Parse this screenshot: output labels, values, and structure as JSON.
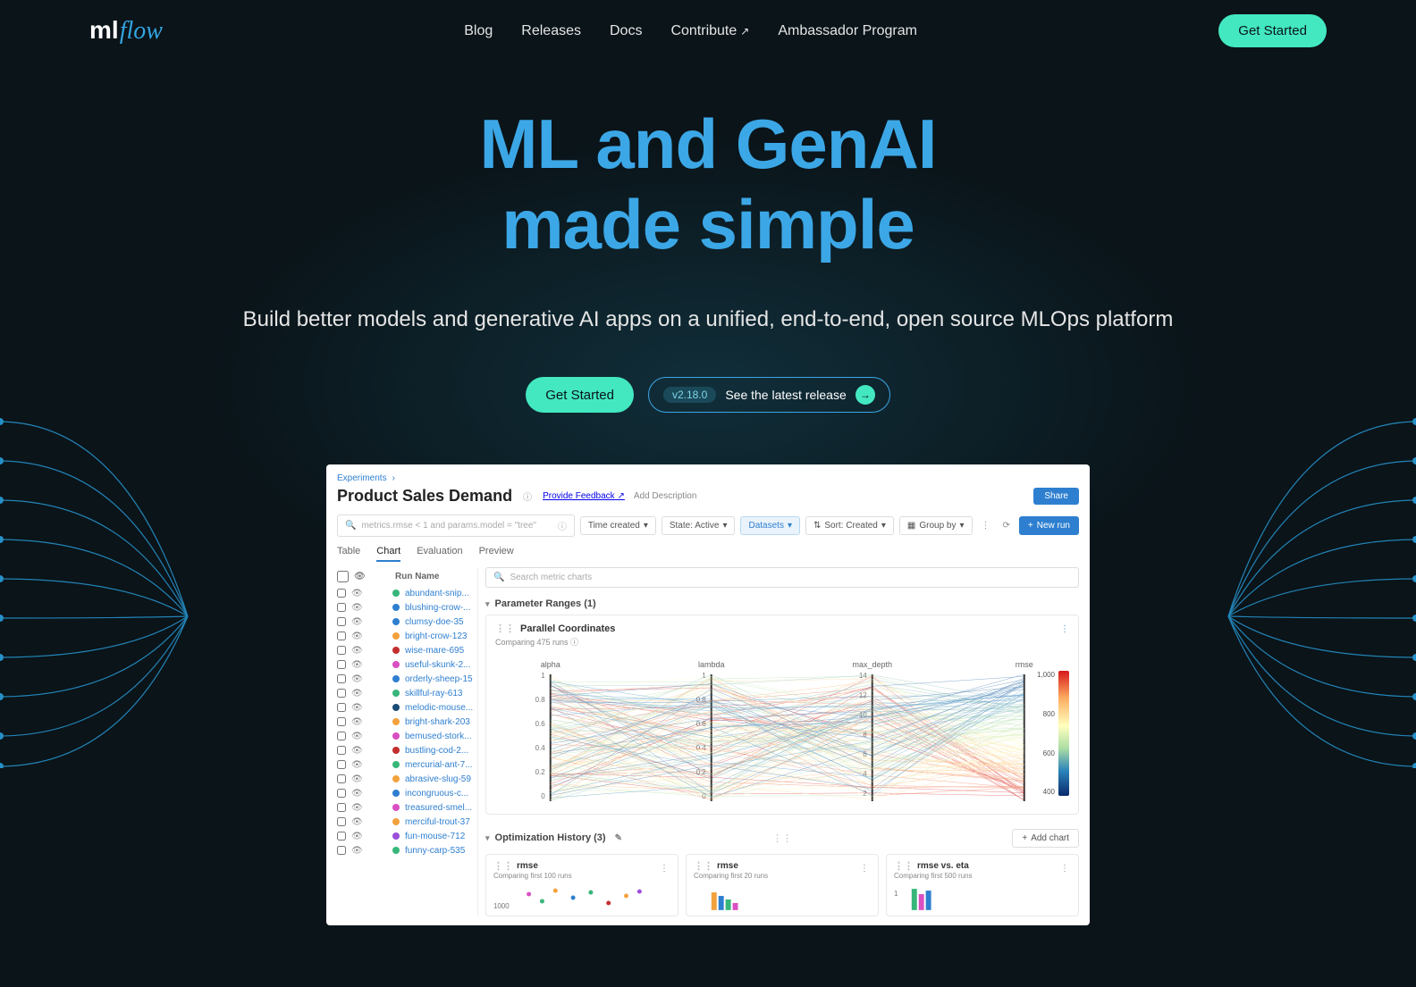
{
  "nav": {
    "logo_ml": "ml",
    "logo_flow": "flow",
    "links": [
      "Blog",
      "Releases",
      "Docs",
      "Contribute",
      "Ambassador Program"
    ],
    "cta": "Get Started"
  },
  "hero": {
    "title_line1": "ML and GenAI",
    "title_line2": "made simple",
    "subtitle": "Build better models and generative AI apps on a unified, end-to-end, open source MLOps platform",
    "cta_primary": "Get Started",
    "release_version": "v2.18.0",
    "release_label": "See the latest release"
  },
  "screenshot": {
    "breadcrumb": "Experiments",
    "title": "Product Sales Demand",
    "feedback": "Provide Feedback",
    "add_desc": "Add Description",
    "share": "Share",
    "search_value": "metrics.rmse < 1 and params.model = \"tree\"",
    "filters": {
      "time": "Time created",
      "state": "State: Active",
      "datasets": "Datasets",
      "sort": "Sort: Created",
      "group": "Group by"
    },
    "newrun": "New run",
    "tabs": [
      "Table",
      "Chart",
      "Evaluation",
      "Preview"
    ],
    "active_tab": "Chart",
    "run_header": "Run Name",
    "runs": [
      {
        "color": "#37b679",
        "name": "abundant-snip..."
      },
      {
        "color": "#2e7fd0",
        "name": "blushing-crow-..."
      },
      {
        "color": "#2e7fd0",
        "name": "clumsy-doe-35"
      },
      {
        "color": "#f2a23d",
        "name": "bright-crow-123"
      },
      {
        "color": "#c32f2f",
        "name": "wise-mare-695"
      },
      {
        "color": "#d94fc2",
        "name": "useful-skunk-2..."
      },
      {
        "color": "#2e7fd0",
        "name": "orderly-sheep-15"
      },
      {
        "color": "#37b679",
        "name": "skillful-ray-613"
      },
      {
        "color": "#1b4c78",
        "name": "melodic-mouse..."
      },
      {
        "color": "#f2a23d",
        "name": "bright-shark-203"
      },
      {
        "color": "#d94fc2",
        "name": "bemused-stork..."
      },
      {
        "color": "#c32f2f",
        "name": "bustling-cod-2..."
      },
      {
        "color": "#37b679",
        "name": "mercurial-ant-7..."
      },
      {
        "color": "#f2a23d",
        "name": "abrasive-slug-59"
      },
      {
        "color": "#2e7fd0",
        "name": "incongruous-c..."
      },
      {
        "color": "#d94fc2",
        "name": "treasured-smel..."
      },
      {
        "color": "#f2a23d",
        "name": "merciful-trout-37"
      },
      {
        "color": "#9c4fd9",
        "name": "fun-mouse-712"
      },
      {
        "color": "#37b679",
        "name": "funny-carp-535"
      }
    ],
    "chart_search_placeholder": "Search metric charts",
    "param_ranges": "Parameter Ranges (1)",
    "parallel": {
      "title": "Parallel Coordinates",
      "sub": "Comparing 475 runs",
      "axes": [
        "alpha",
        "lambda",
        "max_depth",
        "rmse"
      ],
      "ticks_01": [
        "1",
        "0.8",
        "0.6",
        "0.4",
        "0.2",
        "0"
      ],
      "depth_ticks": [
        "14",
        "12",
        "10",
        "8",
        "6",
        "4",
        "2"
      ],
      "cb_labels": [
        "1,000",
        "800",
        "600",
        "400"
      ]
    },
    "opt_history": "Optimization History (3)",
    "add_chart": "Add chart",
    "panels": [
      {
        "title": "rmse",
        "sub": "Comparing first 100 runs"
      },
      {
        "title": "rmse",
        "sub": "Comparing first 20 runs"
      },
      {
        "title": "rmse vs. eta",
        "sub": "Comparing first 500 runs"
      }
    ],
    "ytick": "1000"
  }
}
